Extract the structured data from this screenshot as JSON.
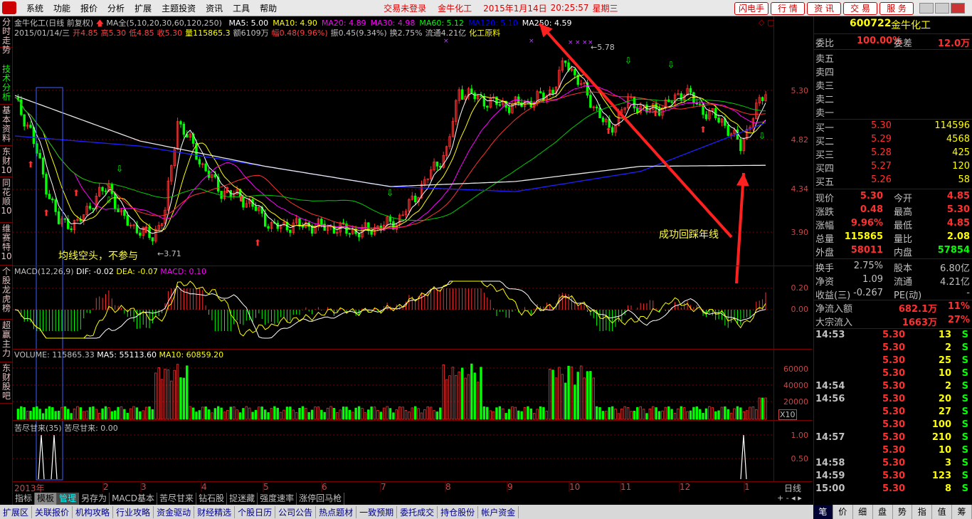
{
  "menu": {
    "items": [
      "系统",
      "功能",
      "报价",
      "分析",
      "扩展",
      "主题投资",
      "资讯",
      "工具",
      "帮助"
    ],
    "status": [
      "交易未登录",
      "金牛化工",
      "2015年1月14日",
      "20:25:57",
      "星期三"
    ],
    "right_buttons": [
      "闪电手",
      "行  情",
      "资  讯",
      "交  易",
      "服  务"
    ]
  },
  "left_tabs": [
    "分时走势",
    "技术分析",
    "基本资料",
    "东财10",
    "同花顺10",
    "维赛特10",
    "个股龙虎榜",
    "超赢主力",
    "东财股吧"
  ],
  "chart": {
    "title_line": "金牛化工(日线 前复权)",
    "ma_label": "MA全(5,10,20,30,60,120,250)",
    "ma": [
      {
        "t": "MA5: 5.00",
        "c": "#ffffff"
      },
      {
        "t": "MA10: 4.90",
        "c": "#ffff00"
      },
      {
        "t": "MA20: 4.89",
        "c": "#ff00ff"
      },
      {
        "t": "MA30: 4.98",
        "c": "#ff00ff"
      },
      {
        "t": "MA60: 5.12",
        "c": "#00ff00"
      },
      {
        "t": "MA120: 5.10",
        "c": "#0000ff"
      },
      {
        "t": "MA250: 4.59",
        "c": "#ffffff"
      }
    ],
    "info_line": [
      {
        "t": "2015/01/14/三",
        "c": "#c0c0c0"
      },
      {
        "t": "开4.85",
        "c": "#ff4040"
      },
      {
        "t": "高5.30",
        "c": "#ff4040"
      },
      {
        "t": "低4.85",
        "c": "#ff4040"
      },
      {
        "t": "收5.30",
        "c": "#ff4040"
      },
      {
        "t": "量115865.3",
        "c": "#ffff00"
      },
      {
        "t": "额6109万",
        "c": "#c0c0c0"
      },
      {
        "t": "幅0.48(9.96%)",
        "c": "#ff4040"
      },
      {
        "t": "振0.45(9.34%)",
        "c": "#c0c0c0"
      },
      {
        "t": "换2.75%",
        "c": "#c0c0c0"
      },
      {
        "t": "流通4.21亿",
        "c": "#c0c0c0"
      },
      {
        "t": "化工原料",
        "c": "#ffff00"
      }
    ],
    "price_axis": [
      "5.30",
      "4.82",
      "4.34",
      "3.90"
    ],
    "high_label": "5.78",
    "low_label": "3.71",
    "annot1": "均线空头，不参与",
    "annot2": "成功回踩年线",
    "macd_title": "MACD(12,26,9)",
    "macd_dif": "DIF: -0.02",
    "macd_dea": "DEA: -0.07",
    "macd_val": "MACD: 0.10",
    "macd_axis": [
      "0.20",
      "0.00"
    ],
    "vol_title": "VOLUME: 115865.33",
    "vol_ma5": "MA5: 55113.60",
    "vol_ma10": "MA10: 60859.20",
    "vol_axis": [
      "60000",
      "40000",
      "20000"
    ],
    "vol_unit": "X10",
    "ind_title": "苦尽甘来(35)",
    "ind_val": "苦尽甘来: 0.00",
    "ind_axis": [
      "1.00",
      "0.50"
    ],
    "x_labels": [
      "2013年",
      "2",
      "3",
      "4",
      "5",
      "6",
      "7",
      "8",
      "9",
      "10",
      "11",
      "12",
      "1"
    ],
    "period": "日线"
  },
  "right": {
    "code": "600722",
    "name": "金牛化工",
    "webibi": "委比",
    "webibi_v": "100.00%",
    "wecha": "委差",
    "wecha_v": "12.0万",
    "sells": [
      "卖五",
      "卖四",
      "卖三",
      "卖二",
      "卖一"
    ],
    "buys": [
      {
        "l": "买一",
        "p": "5.30",
        "v": "114596"
      },
      {
        "l": "买二",
        "p": "5.29",
        "v": "4568"
      },
      {
        "l": "买三",
        "p": "5.28",
        "v": "425"
      },
      {
        "l": "买四",
        "p": "5.27",
        "v": "120"
      },
      {
        "l": "买五",
        "p": "5.26",
        "v": "58"
      }
    ],
    "stats": [
      {
        "a": "现价",
        "av": "5.30",
        "b": "今开",
        "bv": "4.85"
      },
      {
        "a": "涨跌",
        "av": "0.48",
        "b": "最高",
        "bv": "5.30"
      },
      {
        "a": "涨幅",
        "av": "9.96%",
        "b": "最低",
        "bv": "4.85"
      },
      {
        "a": "总量",
        "av": "115865",
        "b": "量比",
        "bv": "2.08"
      },
      {
        "a": "外盘",
        "av": "58011",
        "b": "内盘",
        "bv": "57854"
      }
    ],
    "stats2": [
      {
        "a": "换手",
        "av": "2.75%",
        "b": "股本",
        "bv": "6.80亿"
      },
      {
        "a": "净资",
        "av": "1.09",
        "b": "流通",
        "bv": "4.21亿"
      },
      {
        "a": "收益(三)",
        "av": "-0.267",
        "b": "PE(动)",
        "bv": "-"
      }
    ],
    "flow": [
      {
        "a": "净流入额",
        "av": "682.1万",
        "bv": "11%"
      },
      {
        "a": "大宗流入",
        "av": "1663万",
        "bv": "27%"
      }
    ],
    "ticks": [
      {
        "t": "14:53",
        "p": "5.30",
        "v": "13",
        "s": "S"
      },
      {
        "t": "",
        "p": "5.30",
        "v": "2",
        "s": "S"
      },
      {
        "t": "",
        "p": "5.30",
        "v": "25",
        "s": "S"
      },
      {
        "t": "",
        "p": "5.30",
        "v": "10",
        "s": "S"
      },
      {
        "t": "14:54",
        "p": "5.30",
        "v": "2",
        "s": "S"
      },
      {
        "t": "14:56",
        "p": "5.30",
        "v": "20",
        "s": "S"
      },
      {
        "t": "",
        "p": "5.30",
        "v": "27",
        "s": "S"
      },
      {
        "t": "",
        "p": "5.30",
        "v": "100",
        "s": "S"
      },
      {
        "t": "14:57",
        "p": "5.30",
        "v": "210",
        "s": "S"
      },
      {
        "t": "",
        "p": "5.30",
        "v": "10",
        "s": "S"
      },
      {
        "t": "14:58",
        "p": "5.30",
        "v": "3",
        "s": "S"
      },
      {
        "t": "14:59",
        "p": "5.30",
        "v": "123",
        "s": "S"
      },
      {
        "t": "15:00",
        "p": "5.30",
        "v": "8",
        "s": "S"
      }
    ]
  },
  "bottom_tabs": [
    "指标",
    "模板",
    "管理",
    "另存为",
    "MACD基本",
    "苦尽甘来",
    "钻石股",
    "捉迷藏",
    "强度速率",
    "涨停回马枪"
  ],
  "foot": [
    "扩展区",
    "关联报价",
    "机构攻略",
    "行业攻略",
    "资金驱动",
    "财经精选",
    "个股日历",
    "公司公告",
    "热点题材",
    "一致预期",
    "委托成交",
    "持仓股份",
    "帐户资金"
  ],
  "foot_right": [
    "笔",
    "价",
    "细",
    "盘",
    "势",
    "指",
    "值",
    "筹"
  ],
  "colors": {
    "up": "#ff3030",
    "down": "#00ff00",
    "frame": "#7a0000",
    "accent": "#ffff00"
  }
}
